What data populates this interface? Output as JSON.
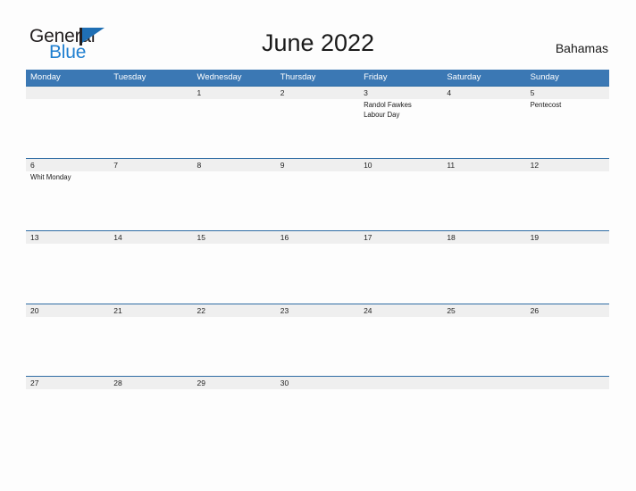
{
  "brand": {
    "name_top": "General",
    "name_bottom": "Blue",
    "accent_color": "#1f7fd0",
    "flag_color": "#1f6fb4"
  },
  "header": {
    "month_title": "June 2022",
    "country": "Bahamas"
  },
  "calendar": {
    "header_bg": "#3b78b4",
    "row_bg": "#efefef",
    "rule_color": "#2e6ca4",
    "weekdays": [
      "Monday",
      "Tuesday",
      "Wednesday",
      "Thursday",
      "Friday",
      "Saturday",
      "Sunday"
    ],
    "weeks": [
      {
        "days": [
          {
            "num": "",
            "events": []
          },
          {
            "num": "",
            "events": []
          },
          {
            "num": "1",
            "events": []
          },
          {
            "num": "2",
            "events": []
          },
          {
            "num": "3",
            "events": [
              "Randol Fawkes",
              "Labour Day"
            ]
          },
          {
            "num": "4",
            "events": []
          },
          {
            "num": "5",
            "events": [
              "Pentecost"
            ]
          }
        ]
      },
      {
        "days": [
          {
            "num": "6",
            "events": [
              "Whit Monday"
            ]
          },
          {
            "num": "7",
            "events": []
          },
          {
            "num": "8",
            "events": []
          },
          {
            "num": "9",
            "events": []
          },
          {
            "num": "10",
            "events": []
          },
          {
            "num": "11",
            "events": []
          },
          {
            "num": "12",
            "events": []
          }
        ]
      },
      {
        "days": [
          {
            "num": "13",
            "events": []
          },
          {
            "num": "14",
            "events": []
          },
          {
            "num": "15",
            "events": []
          },
          {
            "num": "16",
            "events": []
          },
          {
            "num": "17",
            "events": []
          },
          {
            "num": "18",
            "events": []
          },
          {
            "num": "19",
            "events": []
          }
        ]
      },
      {
        "days": [
          {
            "num": "20",
            "events": []
          },
          {
            "num": "21",
            "events": []
          },
          {
            "num": "22",
            "events": []
          },
          {
            "num": "23",
            "events": []
          },
          {
            "num": "24",
            "events": []
          },
          {
            "num": "25",
            "events": []
          },
          {
            "num": "26",
            "events": []
          }
        ]
      },
      {
        "days": [
          {
            "num": "27",
            "events": []
          },
          {
            "num": "28",
            "events": []
          },
          {
            "num": "29",
            "events": []
          },
          {
            "num": "30",
            "events": []
          },
          {
            "num": "",
            "events": []
          },
          {
            "num": "",
            "events": []
          },
          {
            "num": "",
            "events": []
          }
        ]
      }
    ]
  }
}
